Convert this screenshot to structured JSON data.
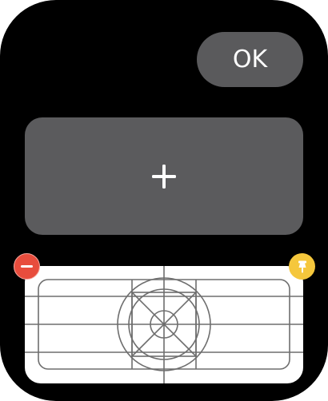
{
  "toolbar": {
    "ok_label": "OK"
  },
  "tiles": [
    {
      "kind": "add-placeholder",
      "icon": "plus-icon"
    },
    {
      "kind": "complication-template",
      "icon": "app-icon-template-grid"
    }
  ],
  "badges": {
    "remove_icon": "minus-circle-icon",
    "pin_icon": "pin-icon"
  },
  "colors": {
    "background": "#000000",
    "tile_gray": "#5b5b5d",
    "button_gray": "#5a5a5c",
    "remove_red": "#e84d3d",
    "pin_yellow": "#f5c73c",
    "template_line": "#6e6e6e"
  }
}
